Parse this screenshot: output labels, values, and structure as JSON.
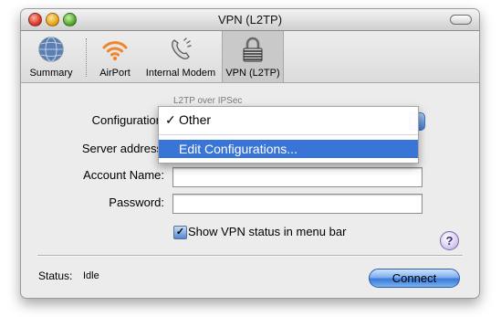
{
  "window": {
    "title": "VPN (L2TP)"
  },
  "toolbar": {
    "items": [
      {
        "label": "Summary",
        "icon": "globe-icon"
      },
      {
        "label": "AirPort",
        "icon": "airport-icon"
      },
      {
        "label": "Internal Modem",
        "icon": "phone-icon"
      },
      {
        "label": "VPN (L2TP)",
        "icon": "lock-icon",
        "selected": true
      }
    ]
  },
  "panel": {
    "subtitle": "L2TP over IPSec"
  },
  "form": {
    "configuration_label": "Configuration",
    "server_label": "Server address",
    "account_label": "Account Name:",
    "account_value": "",
    "password_label": "Password:",
    "password_value": ""
  },
  "config_menu": {
    "items": [
      {
        "label": "Other",
        "checked": true
      },
      {
        "label": "Edit Configurations...",
        "highlighted": true
      }
    ]
  },
  "show_status": {
    "label": "Show VPN status in menu bar",
    "checked": true,
    "check_glyph": "✓"
  },
  "help": {
    "glyph": "?"
  },
  "status": {
    "label": "Status:",
    "value": "Idle"
  },
  "connect_button": {
    "label": "Connect"
  },
  "colors": {
    "highlight": "#3875d7",
    "window_bg": "#ececec",
    "button_blue": "#3a7ad8"
  }
}
